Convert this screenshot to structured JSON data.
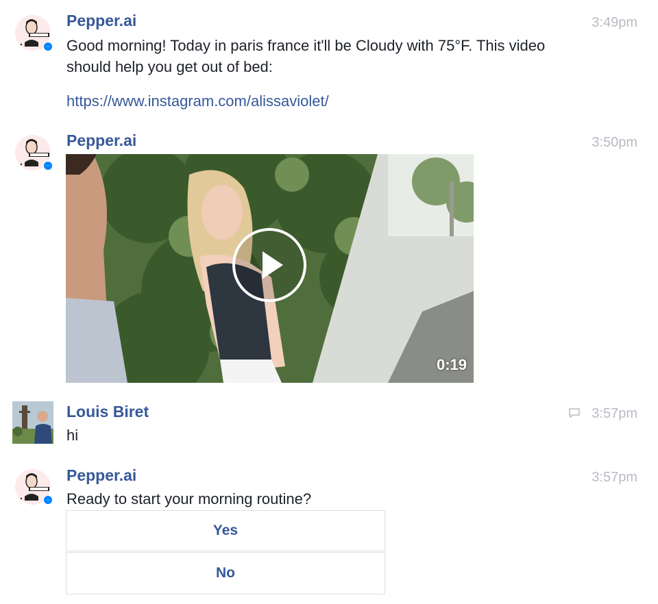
{
  "colors": {
    "sender": "#365899",
    "link": "#365899",
    "timestamp": "#b7bbc2",
    "text": "#1d2129",
    "messenger_badge": "#0084ff"
  },
  "messages": [
    {
      "sender": "Pepper.ai",
      "time": "3:49pm",
      "text": "Good morning! Today in paris france it'll be Cloudy with 75°F. This video should help you get out of bed:",
      "link": "https://www.instagram.com/alissaviolet/",
      "avatar_icon": "pepper-bot-avatar",
      "badge_icon": "messenger-badge-icon"
    },
    {
      "sender": "Pepper.ai",
      "time": "3:50pm",
      "video": {
        "duration": "0:19",
        "play_icon": "play-icon"
      },
      "avatar_icon": "pepper-bot-avatar",
      "badge_icon": "messenger-badge-icon"
    },
    {
      "sender": "Louis Biret",
      "time": "3:57pm",
      "text": "hi",
      "avatar_icon": "user-photo-avatar",
      "status_icon": "seen-bubble-icon"
    },
    {
      "sender": "Pepper.ai",
      "time": "3:57pm",
      "text": "Ready to start your morning routine?",
      "avatar_icon": "pepper-bot-avatar",
      "badge_icon": "messenger-badge-icon",
      "quick_replies": [
        "Yes",
        "No"
      ]
    }
  ]
}
